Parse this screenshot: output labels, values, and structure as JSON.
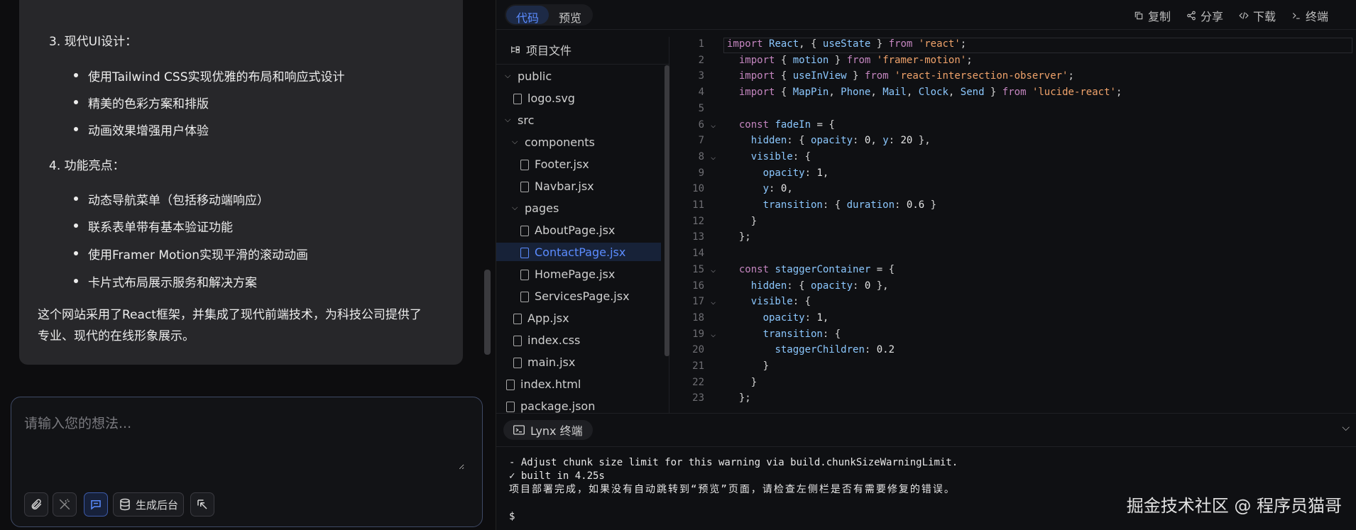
{
  "chat": {
    "section3_title": "3. 现代UI设计：",
    "section3_items": [
      "使用Tailwind CSS实现优雅的布局和响应式设计",
      "精美的色彩方案和排版",
      "动画效果增强用户体验"
    ],
    "section4_title": "4. 功能亮点：",
    "section4_items": [
      "动态导航菜单（包括移动端响应）",
      "联系表单带有基本验证功能",
      "使用Framer Motion实现平滑的滚动动画",
      "卡片式布局展示服务和解决方案"
    ],
    "summary_line1": "这个网站采用了React框架，并集成了现代前端技术，为科技公司提供了",
    "summary_line2": "专业、现代的在线形象展示。"
  },
  "composer": {
    "placeholder": "请输入您的想法...",
    "generate_backend_label": "生成后台"
  },
  "ide": {
    "tabs": [
      {
        "label": "代码",
        "active": true
      },
      {
        "label": "预览",
        "active": false
      }
    ],
    "actions": {
      "copy": "复制",
      "share": "分享",
      "download": "下载",
      "terminal": "终端"
    },
    "tree_title": "项目文件",
    "tree": [
      {
        "label": "public",
        "type": "folder",
        "open": true
      },
      {
        "label": "logo.svg",
        "type": "file"
      },
      {
        "label": "src",
        "type": "folder",
        "open": true
      },
      {
        "label": "components",
        "type": "folder",
        "open": true
      },
      {
        "label": "Footer.jsx",
        "type": "file"
      },
      {
        "label": "Navbar.jsx",
        "type": "file"
      },
      {
        "label": "pages",
        "type": "folder",
        "open": true
      },
      {
        "label": "AboutPage.jsx",
        "type": "file"
      },
      {
        "label": "ContactPage.jsx",
        "type": "file",
        "selected": true
      },
      {
        "label": "HomePage.jsx",
        "type": "file"
      },
      {
        "label": "ServicesPage.jsx",
        "type": "file"
      },
      {
        "label": "App.jsx",
        "type": "file"
      },
      {
        "label": "index.css",
        "type": "file"
      },
      {
        "label": "main.jsx",
        "type": "file"
      },
      {
        "label": "index.html",
        "type": "file"
      },
      {
        "label": "package.json",
        "type": "file"
      }
    ],
    "code_lines": [
      "import React, { useState } from 'react';",
      "  import { motion } from 'framer-motion';",
      "  import { useInView } from 'react-intersection-observer';",
      "  import { MapPin, Phone, Mail, Clock, Send } from 'lucide-react';",
      "",
      "  const fadeIn = {",
      "    hidden: { opacity: 0, y: 20 },",
      "    visible: {",
      "      opacity: 1,",
      "      y: 0,",
      "      transition: { duration: 0.6 }",
      "    }",
      "  };",
      "",
      "  const staggerContainer = {",
      "    hidden: { opacity: 0 },",
      "    visible: {",
      "      opacity: 1,",
      "      transition: {",
      "        staggerChildren: 0.2",
      "      }",
      "    }",
      "  };"
    ],
    "fold_lines": [
      6,
      8,
      15,
      17,
      19
    ],
    "terminal_tab": "Lynx 终端",
    "terminal_lines": [
      "- Adjust chunk size limit for this warning via build.chunkSizeWarningLimit.",
      "✓ built in 4.25s",
      "项目部署完成，如果没有自动跳转到“预览”页面，请检查左侧栏是否有需要修复的错误。",
      "",
      "$"
    ],
    "watermark": "掘金技术社区 @ 程序员猫哥"
  },
  "colors": {
    "accent": "#5b8cff",
    "card": "#27272a",
    "background": "#0d0d0f"
  }
}
